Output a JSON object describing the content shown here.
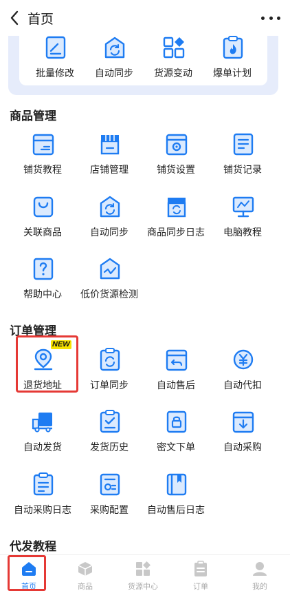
{
  "header": {
    "title": "首页",
    "back_icon": "chevron-left-icon",
    "more_icon": "more-dots-icon"
  },
  "quick_actions": [
    {
      "label": "批量修改",
      "icon": "edit-document-icon"
    },
    {
      "label": "自动同步",
      "icon": "sync-box-icon"
    },
    {
      "label": "货源变动",
      "icon": "grid-diamond-icon"
    },
    {
      "label": "爆单计划",
      "icon": "fire-clipboard-icon"
    }
  ],
  "sections": {
    "goods": {
      "title": "商品管理",
      "items": [
        {
          "label": "铺货教程",
          "icon": "box-tutorial-icon"
        },
        {
          "label": "店铺管理",
          "icon": "store-icon"
        },
        {
          "label": "铺货设置",
          "icon": "box-settings-icon"
        },
        {
          "label": "铺货记录",
          "icon": "record-list-icon"
        },
        {
          "label": "关联商品",
          "icon": "shopping-bag-icon"
        },
        {
          "label": "自动同步",
          "icon": "sync-box-icon"
        },
        {
          "label": "商品同步日志",
          "icon": "store-sync-icon"
        },
        {
          "label": "电脑教程",
          "icon": "monitor-icon"
        },
        {
          "label": "帮助中心",
          "icon": "help-icon"
        },
        {
          "label": "低价货源检测",
          "icon": "price-chart-icon"
        }
      ]
    },
    "orders": {
      "title": "订单管理",
      "items": [
        {
          "label": "退货地址",
          "icon": "location-pin-icon",
          "badge": "NEW"
        },
        {
          "label": "订单同步",
          "icon": "order-sync-icon"
        },
        {
          "label": "自动售后",
          "icon": "return-box-icon"
        },
        {
          "label": "自动代扣",
          "icon": "yen-sync-icon"
        },
        {
          "label": "自动发货",
          "icon": "truck-icon"
        },
        {
          "label": "发货历史",
          "icon": "history-check-icon"
        },
        {
          "label": "密文下单",
          "icon": "lock-document-icon"
        },
        {
          "label": "自动采购",
          "icon": "purchase-box-icon"
        },
        {
          "label": "自动采购日志",
          "icon": "purchase-log-icon"
        },
        {
          "label": "采购配置",
          "icon": "config-document-icon"
        },
        {
          "label": "自动售后日志",
          "icon": "aftersale-log-icon"
        }
      ]
    },
    "tutorial": {
      "title": "代发教程"
    }
  },
  "tabbar": [
    {
      "label": "首页",
      "icon": "home-icon",
      "active": true
    },
    {
      "label": "商品",
      "icon": "cube-icon",
      "active": false
    },
    {
      "label": "货源中心",
      "icon": "grid-diamond-icon",
      "active": false
    },
    {
      "label": "订单",
      "icon": "order-clipboard-icon",
      "active": false
    },
    {
      "label": "我的",
      "icon": "user-icon",
      "active": false
    }
  ],
  "colors": {
    "accent": "#1e7cf2",
    "icon_fill": "#dbeafe",
    "highlight": "#e53935",
    "badge_bg": "#f7e200"
  }
}
